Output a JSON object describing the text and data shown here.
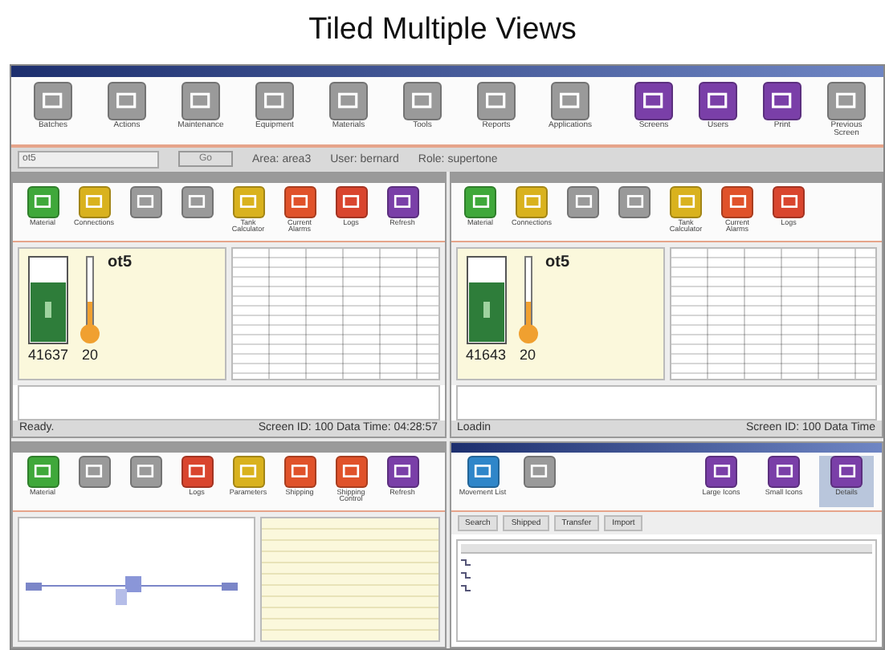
{
  "heading": "Tiled Multiple Views",
  "toolbar": {
    "left": [
      {
        "label": "Batches",
        "color": "#9a9a9a"
      },
      {
        "label": "Actions",
        "color": "#9a9a9a"
      },
      {
        "label": "Maintenance",
        "color": "#9a9a9a"
      },
      {
        "label": "Equipment",
        "color": "#9a9a9a"
      },
      {
        "label": "Materials",
        "color": "#9a9a9a"
      },
      {
        "label": "Tools",
        "color": "#9a9a9a"
      },
      {
        "label": "Reports",
        "color": "#9a9a9a"
      },
      {
        "label": "Applications",
        "color": "#9a9a9a"
      }
    ],
    "right": [
      {
        "label": "Screens",
        "color": "#7a3fa8"
      },
      {
        "label": "Users",
        "color": "#7a3fa8"
      },
      {
        "label": "Print",
        "color": "#7a3fa8"
      },
      {
        "label": "Previous Screen",
        "color": "#9a9a9a"
      }
    ]
  },
  "infobar": {
    "value": "ot5",
    "go": "Go",
    "area": "Area: area3",
    "user": "User: bernard",
    "role": "Role: supertone"
  },
  "tank_views": [
    {
      "buttons": [
        {
          "label": "Material",
          "color": "#3fa83a"
        },
        {
          "label": "Connections",
          "color": "#d9b21e"
        },
        {
          "color": "#9a9a9a"
        },
        {
          "color": "#9a9a9a"
        },
        {
          "label": "Tank Calculator",
          "color": "#d9b21e"
        },
        {
          "label": "Current Alarms",
          "color": "#e0522a"
        },
        {
          "label": "Logs",
          "color": "#d9452e"
        },
        {
          "label": "Refresh",
          "color": "#7a3fa8"
        }
      ],
      "tank_name": "ot5",
      "tank_reading": "41637",
      "temp_reading": "20",
      "status": "Ready.",
      "screen_info": "Screen ID: 100   Data Time: 04:28:57"
    },
    {
      "buttons": [
        {
          "label": "Material",
          "color": "#3fa83a"
        },
        {
          "label": "Connections",
          "color": "#d9b21e"
        },
        {
          "color": "#9a9a9a"
        },
        {
          "color": "#9a9a9a"
        },
        {
          "label": "Tank Calculator",
          "color": "#d9b21e"
        },
        {
          "label": "Current Alarms",
          "color": "#e0522a"
        },
        {
          "label": "Logs",
          "color": "#d9452e"
        }
      ],
      "tank_name": "ot5",
      "tank_reading": "41643",
      "temp_reading": "20",
      "status": "Loadin",
      "screen_info": "Screen ID: 100   Data Time"
    }
  ],
  "route_view": {
    "buttons": [
      {
        "label": "Material",
        "color": "#3fa83a"
      },
      {
        "color": "#9a9a9a"
      },
      {
        "color": "#9a9a9a"
      },
      {
        "label": "Logs",
        "color": "#d9452e"
      },
      {
        "label": "Parameters",
        "color": "#d9b21e"
      },
      {
        "label": "Shipping",
        "color": "#e0522a"
      },
      {
        "label": "Shipping Control",
        "color": "#e0522a"
      },
      {
        "label": "Refresh",
        "color": "#7a3fa8"
      }
    ]
  },
  "movement_selector": {
    "buttons": [
      {
        "label": "Movement List",
        "color": "#2f86c9"
      },
      {
        "color": "#9a9a9a"
      }
    ],
    "view_buttons": [
      {
        "label": "Large Icons",
        "color": "#7a3fa8",
        "selected": false
      },
      {
        "label": "Small Icons",
        "color": "#7a3fa8",
        "selected": false
      },
      {
        "label": "Details",
        "color": "#7a3fa8",
        "selected": true
      }
    ],
    "tabs": [
      {
        "label": "Search",
        "selected": false
      },
      {
        "label": "Shipped",
        "selected": false
      },
      {
        "label": "Transfer",
        "selected": false
      },
      {
        "label": "Import",
        "selected": false
      }
    ]
  }
}
